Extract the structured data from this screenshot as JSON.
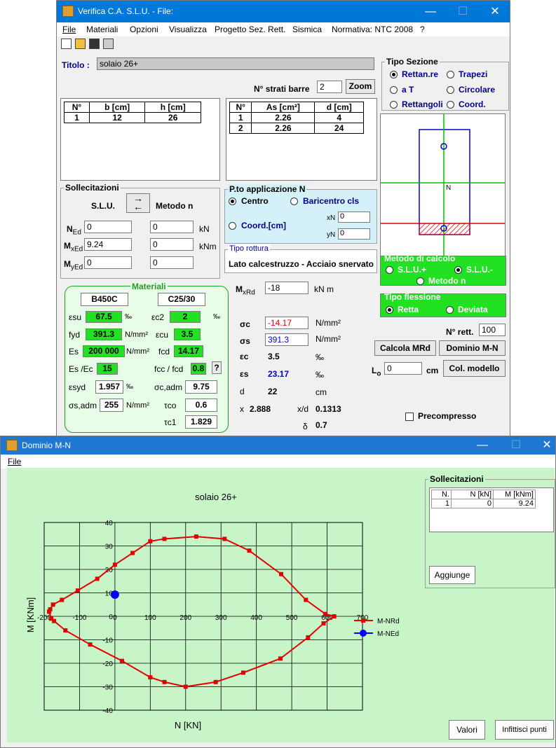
{
  "win1": {
    "title": "Verifica C.A. S.L.U. - File:",
    "menu": [
      "File",
      "Materiali",
      "Opzioni",
      "Visualizza",
      "Progetto Sez. Rett.",
      "Sismica",
      "Normativa: NTC 2008",
      "?"
    ],
    "titolo_label": "Titolo :",
    "titolo_value": "solaio 26+",
    "strati_label": "N° strati barre",
    "strati_value": "2",
    "zoom": "Zoom",
    "tipo_sezione": {
      "title": "Tipo Sezione",
      "options": [
        "Rettan.re",
        "Trapezi",
        "a T",
        "Circolare",
        "Rettangoli",
        "Coord."
      ],
      "selected": "Rettan.re"
    },
    "geom_table": {
      "headers": [
        "N°",
        "b [cm]",
        "h [cm]"
      ],
      "rows": [
        [
          "1",
          "12",
          "26"
        ]
      ]
    },
    "bar_table": {
      "headers": [
        "N°",
        "As [cm²]",
        "d [cm]"
      ],
      "rows": [
        [
          "1",
          "2.26",
          "4"
        ],
        [
          "2",
          "2.26",
          "24"
        ]
      ]
    },
    "sollecitazioni": {
      "title": "Sollecitazioni",
      "slu": "S.L.U.",
      "metodo": "Metodo n",
      "ned_label": "N",
      "ned_sub": "Ed",
      "mxed_label": "M",
      "mxed_sub": "xEd",
      "myed_label": "M",
      "myed_sub": "yEd",
      "ned": "0",
      "mxed": "9.24",
      "myed": "0",
      "ned_n": "0",
      "mxed_n": "0",
      "myed_n": "0",
      "unit_kn": "kN",
      "unit_knm": "kNm"
    },
    "pto_applicazione": {
      "title": "P.to applicazione N",
      "centro": "Centro",
      "baricentro": "Baricentro cls",
      "coord": "Coord.[cm]",
      "xn_label": "xN",
      "yn_label": "yN",
      "xn": "0",
      "yn": "0"
    },
    "tipo_rottura": {
      "title": "Tipo rottura",
      "value": "Lato calcestruzzo - Acciaio snervato"
    },
    "metodo_calcolo": {
      "title": "Metodo di calcolo",
      "slu_plus": "S.L.U.+",
      "slu_minus": "S.L.U.-",
      "metodo_n": "Metodo n"
    },
    "tipo_flessione": {
      "title": "Tipo flessione",
      "retta": "Retta",
      "deviata": "Deviata"
    },
    "n_rett_label": "N° rett.",
    "n_rett": "100",
    "calcola": "Calcola MRd",
    "dominio": "Dominio M-N",
    "lo_label": "L",
    "lo_sub": "o",
    "lo_value": "0",
    "lo_unit": "cm",
    "col_modello": "Col. modello",
    "precompresso": "Precompresso",
    "materiali": {
      "title": "Materiali",
      "steel": "B450C",
      "concrete": "C25/30",
      "esu_label": "εsu",
      "esu": "67.5",
      "esu_unit": "‰",
      "ec2_label": "εc2",
      "ec2": "2",
      "ec2_unit": "‰",
      "fyd_label": "fyd",
      "fyd": "391.3",
      "fyd_unit": "N/mm²",
      "ecu_label": "εcu",
      "ecu": "3.5",
      "es_label": "Es",
      "es": "200 000",
      "es_unit": "N/mm²",
      "fcd_label": "fcd",
      "fcd": "14.17",
      "esec_label": "Es /Ec",
      "esec": "15",
      "fccfcd_label": "fcc / fcd",
      "fccfcd": "0.8",
      "q": "?",
      "esyd_label": "εsyd",
      "esyd": "1.957",
      "esyd_unit": "‰",
      "scadm_label": "σc,adm",
      "scadm": "9.75",
      "ssadm_label": "σs,adm",
      "ssadm": "255",
      "ssadm_unit": "N/mm²",
      "tco_label": "τco",
      "tco": "0.6",
      "tc1_label": "τc1",
      "tc1": "1.829"
    },
    "results": {
      "mxrd_label": "M",
      "mxrd_sub": "xRd",
      "mxrd": "-18",
      "mxrd_unit": "kN m",
      "sc_label": "σc",
      "sc": "-14.17",
      "sc_unit": "N/mm²",
      "ss_label": "σs",
      "ss": "391.3",
      "ss_unit": "N/mm²",
      "ec_label": "εc",
      "ec": "3.5",
      "ec_unit": "‰",
      "es_label": "εs",
      "es": "23.17",
      "es_unit": "‰",
      "d_label": "d",
      "d": "22",
      "d_unit": "cm",
      "x_label": "x",
      "x": "2.888",
      "xd_label": "x/d",
      "xd": "0.1313",
      "delta_label": "δ",
      "delta": "0.7"
    },
    "section_label_N": "N"
  },
  "win2": {
    "title": "Dominio M-N",
    "menu": "File",
    "sollecitazioni": {
      "title": "Sollecitazioni",
      "headers": [
        "N.",
        "N [kN]",
        "M [kNm]"
      ],
      "rows": [
        [
          "1",
          "0",
          "9.24"
        ]
      ]
    },
    "aggiunge": "Aggiunge",
    "valori": "Valori",
    "infittisci": "Infittisci punti"
  },
  "chart_data": {
    "type": "line",
    "title": "solaio 26+",
    "xlabel": "N [KN]",
    "ylabel": "M [KNm]",
    "xlim": [
      -200,
      700
    ],
    "ylim": [
      -40,
      40
    ],
    "xticks": [
      -200,
      -100,
      0,
      100,
      200,
      300,
      400,
      500,
      600,
      700
    ],
    "yticks": [
      -40,
      -30,
      -20,
      -10,
      0,
      10,
      20,
      30,
      40
    ],
    "grid": true,
    "legend": "right",
    "series": [
      {
        "name": "M-NRd",
        "color": "#e00000",
        "x": [
          -186,
          -180,
          -172,
          -140,
          -70,
          20,
          100,
          140,
          200,
          285,
          363,
          468,
          546,
          590,
          620,
          595,
          540,
          470,
          380,
          310,
          230,
          140,
          100,
          50,
          0,
          -50,
          -105,
          -150,
          -175,
          -183,
          -186
        ],
        "y": [
          2,
          -1,
          -2,
          -6,
          -12,
          -19,
          -26,
          -28,
          -30,
          -28,
          -24,
          -18,
          -9,
          -3,
          0,
          1,
          7,
          18,
          28,
          33,
          34,
          33,
          32,
          27,
          22,
          16,
          11,
          7,
          5,
          3,
          2
        ]
      },
      {
        "name": "M-NEd",
        "color": "#0000ff",
        "x": [
          0
        ],
        "y": [
          9.24
        ]
      }
    ]
  }
}
